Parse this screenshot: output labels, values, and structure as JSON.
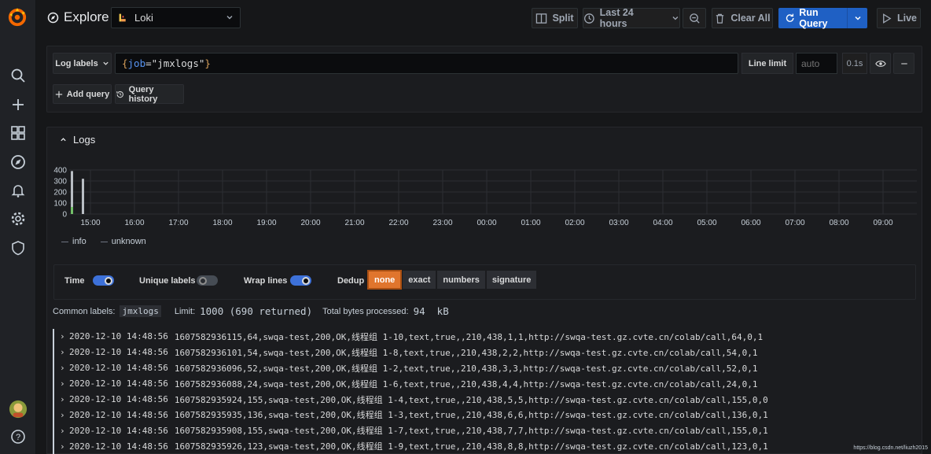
{
  "header": {
    "title": "Explore",
    "datasource": "Loki",
    "split_label": "Split",
    "time_range_label": "Last 24 hours",
    "clear_all_label": "Clear All",
    "run_query_label": "Run Query",
    "live_label": "Live"
  },
  "query": {
    "log_labels_label": "Log labels",
    "expression_brace_open": "{",
    "expression_key": "job",
    "expression_eq": "=",
    "expression_value": "\"jmxlogs\"",
    "expression_brace_close": "}",
    "line_limit_label": "Line limit",
    "line_limit_placeholder": "auto",
    "duration": "0.1s",
    "add_query_label": "Add query",
    "query_history_label": "Query history"
  },
  "logs": {
    "title": "Logs",
    "y_ticks": [
      "400",
      "300",
      "200",
      "100",
      "0"
    ],
    "x_ticks": [
      "15:00",
      "16:00",
      "17:00",
      "18:00",
      "19:00",
      "20:00",
      "21:00",
      "22:00",
      "23:00",
      "00:00",
      "01:00",
      "02:00",
      "03:00",
      "04:00",
      "05:00",
      "06:00",
      "07:00",
      "08:00",
      "09:00"
    ],
    "legend": [
      "info",
      "unknown"
    ],
    "options": {
      "time_label": "Time",
      "time_on": true,
      "unique_labels_label": "Unique labels",
      "unique_labels_on": false,
      "wrap_lines_label": "Wrap lines",
      "wrap_lines_on": true,
      "dedup_label": "Dedup",
      "dedup_options": [
        "none",
        "exact",
        "numbers",
        "signature"
      ],
      "dedup_selected": "none"
    },
    "common_labels_label": "Common labels:",
    "common_labels_value": "jmxlogs",
    "limit_label": "Limit:",
    "limit_value": "1000 (690 returned)",
    "bytes_label": "Total bytes processed:",
    "bytes_value": "94  kB",
    "rows": [
      {
        "ts": "2020-12-10 14:48:56",
        "line": "1607582936115,64,swqa-test,200,OK,线程组 1-10,text,true,,210,438,1,1,http://swqa-test.gz.cvte.cn/colab/call,64,0,1"
      },
      {
        "ts": "2020-12-10 14:48:56",
        "line": "1607582936101,54,swqa-test,200,OK,线程组 1-8,text,true,,210,438,2,2,http://swqa-test.gz.cvte.cn/colab/call,54,0,1"
      },
      {
        "ts": "2020-12-10 14:48:56",
        "line": "1607582936096,52,swqa-test,200,OK,线程组 1-2,text,true,,210,438,3,3,http://swqa-test.gz.cvte.cn/colab/call,52,0,1"
      },
      {
        "ts": "2020-12-10 14:48:56",
        "line": "1607582936088,24,swqa-test,200,OK,线程组 1-6,text,true,,210,438,4,4,http://swqa-test.gz.cvte.cn/colab/call,24,0,1"
      },
      {
        "ts": "2020-12-10 14:48:56",
        "line": "1607582935924,155,swqa-test,200,OK,线程组 1-4,text,true,,210,438,5,5,http://swqa-test.gz.cvte.cn/colab/call,155,0,0"
      },
      {
        "ts": "2020-12-10 14:48:56",
        "line": "1607582935935,136,swqa-test,200,OK,线程组 1-3,text,true,,210,438,6,6,http://swqa-test.gz.cvte.cn/colab/call,136,0,1"
      },
      {
        "ts": "2020-12-10 14:48:56",
        "line": "1607582935908,155,swqa-test,200,OK,线程组 1-7,text,true,,210,438,7,7,http://swqa-test.gz.cvte.cn/colab/call,155,0,1"
      },
      {
        "ts": "2020-12-10 14:48:56",
        "line": "1607582935926,123,swqa-test,200,OK,线程组 1-9,text,true,,210,438,8,8,http://swqa-test.gz.cvte.cn/colab/call,123,0,1"
      }
    ]
  },
  "chart_data": {
    "type": "bar",
    "categories": [
      "15:00",
      "16:00",
      "17:00",
      "18:00",
      "19:00",
      "20:00",
      "21:00",
      "22:00",
      "23:00",
      "00:00",
      "01:00",
      "02:00",
      "03:00",
      "04:00",
      "05:00",
      "06:00",
      "07:00",
      "08:00",
      "09:00"
    ],
    "series": [
      {
        "name": "info",
        "values": [
          390,
          0,
          0,
          0,
          0,
          0,
          0,
          0,
          0,
          0,
          0,
          0,
          0,
          0,
          0,
          0,
          0,
          0,
          0
        ]
      },
      {
        "name": "unknown",
        "values": [
          320,
          0,
          0,
          0,
          0,
          0,
          0,
          0,
          0,
          0,
          0,
          0,
          0,
          0,
          0,
          0,
          0,
          0,
          0
        ]
      }
    ],
    "ylim": [
      0,
      400
    ],
    "grid": true,
    "legend_position": "bottom-left"
  },
  "watermark": "https://blog.csdn.net/liuzh2015",
  "colors": {
    "accent": "#1f60c4",
    "dedup_active": "#e0752d",
    "switch_on": "#3d71d9",
    "grafana_orange": "#f46800"
  }
}
